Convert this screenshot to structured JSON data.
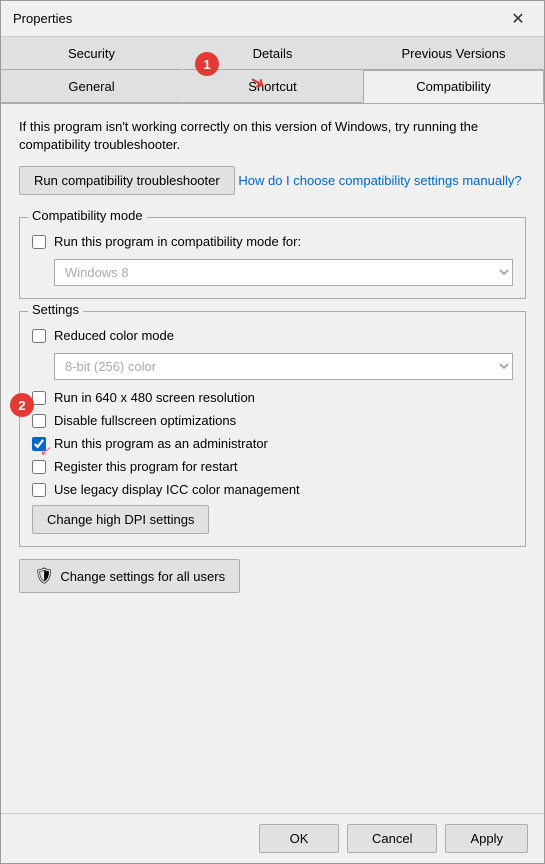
{
  "window": {
    "title": "Properties",
    "close_label": "✕"
  },
  "tabs": {
    "row1": [
      {
        "label": "Security",
        "active": false
      },
      {
        "label": "Details",
        "active": false
      },
      {
        "label": "Previous Versions",
        "active": false
      }
    ],
    "row2": [
      {
        "label": "General",
        "active": false
      },
      {
        "label": "Shortcut",
        "active": false
      },
      {
        "label": "Compatibility",
        "active": true
      }
    ]
  },
  "content": {
    "intro_text": "If this program isn't working correctly on this version of Windows, try running the compatibility troubleshooter.",
    "run_button": "Run compatibility troubleshooter",
    "how_link": "How do I choose compatibility settings manually?",
    "compatibility_mode": {
      "label": "Compatibility mode",
      "checkbox_label": "Run this program in compatibility mode for:",
      "checked": false,
      "dropdown_value": "Windows 8"
    },
    "settings": {
      "label": "Settings",
      "items": [
        {
          "label": "Reduced color mode",
          "checked": false
        },
        {
          "label": "Run in 640 x 480 screen resolution",
          "checked": false
        },
        {
          "label": "Disable fullscreen optimizations",
          "checked": false
        },
        {
          "label": "Run this program as an administrator",
          "checked": true
        },
        {
          "label": "Register this program for restart",
          "checked": false
        },
        {
          "label": "Use legacy display ICC color management",
          "checked": false
        }
      ],
      "color_dropdown": "8-bit (256) color",
      "change_dpi_btn": "Change high DPI settings"
    },
    "change_all_btn": "Change settings for all users"
  },
  "footer": {
    "ok": "OK",
    "cancel": "Cancel",
    "apply": "Apply"
  },
  "annotations": {
    "1": "1",
    "2": "2"
  }
}
